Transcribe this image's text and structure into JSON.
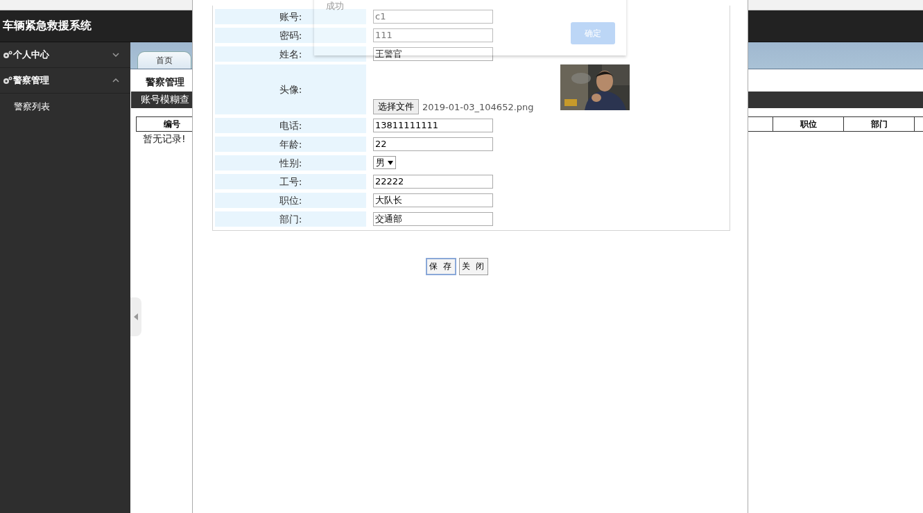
{
  "header": {
    "title": "车辆紧急救援系统"
  },
  "sidebar": {
    "items": [
      {
        "label": "个人中心",
        "expanded": false
      },
      {
        "label": "警察管理",
        "expanded": true,
        "children": [
          {
            "label": "警察列表"
          }
        ]
      }
    ]
  },
  "tabs": [
    {
      "label": "首页",
      "selected": true
    }
  ],
  "page_title": "警察管理",
  "search_bar": {
    "label": "账号模糊查"
  },
  "table": {
    "columns": [
      "编号",
      "职位",
      "部门"
    ],
    "empty_text": "暂无记录!"
  },
  "dialog": {
    "fields": [
      {
        "kind": "text",
        "label": "账号:",
        "value": "c1",
        "disabled": true
      },
      {
        "kind": "text",
        "label": "密码:",
        "value": "111",
        "disabled": true
      },
      {
        "kind": "text",
        "label": "姓名:",
        "value": "王警官",
        "disabled": false
      },
      {
        "kind": "file",
        "label": "头像:",
        "button": "选择文件",
        "file_name": "2019-01-03_104652.png"
      },
      {
        "kind": "text",
        "label": "电话:",
        "value": "13811111111",
        "disabled": false
      },
      {
        "kind": "text",
        "label": "年龄:",
        "value": "22",
        "disabled": false
      },
      {
        "kind": "select",
        "label": "性别:",
        "value": "男"
      },
      {
        "kind": "text",
        "label": "工号:",
        "value": "22222",
        "disabled": false
      },
      {
        "kind": "text",
        "label": "职位:",
        "value": "大队长",
        "disabled": false
      },
      {
        "kind": "text",
        "label": "部门:",
        "value": "交通部",
        "disabled": false
      }
    ],
    "buttons": [
      "保 存",
      "关 闭"
    ]
  },
  "toast": {
    "message": "成功",
    "button": "确定"
  }
}
